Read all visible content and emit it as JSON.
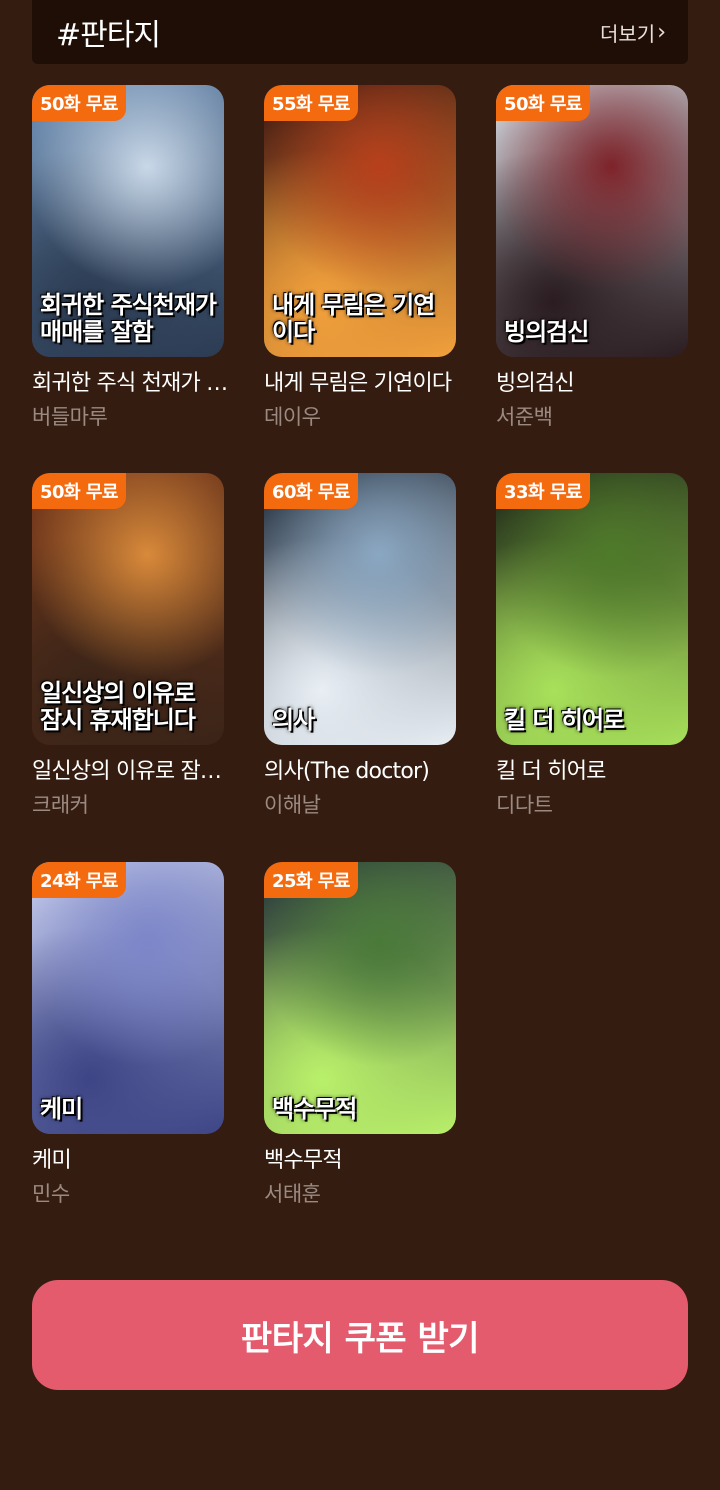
{
  "header": {
    "title": "#판타지",
    "more_label": "더보기",
    "more_icon": "chevron-right-icon"
  },
  "books": [
    {
      "badge": "50화 무료",
      "title": "회귀한 주식 천재가 매매를 잘함",
      "author": "버들마루",
      "cover_text": "회귀한 주식천재가 매매를 잘함",
      "colors": [
        "#6e8fb5",
        "#c9d8e8",
        "#2b3b52"
      ]
    },
    {
      "badge": "55화 무료",
      "title": "내게 무림은 기연이다",
      "author": "데이우",
      "cover_text": "내게 무림은 기연이다",
      "colors": [
        "#3a1410",
        "#b8401c",
        "#f2a13c"
      ]
    },
    {
      "badge": "50화 무료",
      "title": "빙의검신",
      "author": "서준백",
      "cover_text": "빙의검신",
      "colors": [
        "#d7dbe2",
        "#7d2329",
        "#2a1c20"
      ]
    },
    {
      "badge": "50화 무료",
      "title": "일신상의 이유로 잠시 휴재합니다",
      "author": "크래커",
      "cover_text": "일신상의 이유로 잠시 휴재합니다",
      "colors": [
        "#7a3a1c",
        "#d98a3a",
        "#3a2418"
      ]
    },
    {
      "badge": "60화 무료",
      "title": "의사(The doctor)",
      "author": "이해날",
      "cover_text": "의사",
      "colors": [
        "#1c2a3a",
        "#8aa7c2",
        "#e8eef4"
      ]
    },
    {
      "badge": "33화 무료",
      "title": "킬 더 히어로",
      "author": "디다트",
      "cover_text": "킬 더 히어로",
      "colors": [
        "#1a2216",
        "#4f7a2a",
        "#a8e05a"
      ]
    },
    {
      "badge": "24화 무료",
      "title": "케미",
      "author": "민수",
      "cover_text": "케미",
      "colors": [
        "#c8cff0",
        "#7c86c9",
        "#3d4586"
      ]
    },
    {
      "badge": "25화 무료",
      "title": "백수무적",
      "author": "서태훈",
      "cover_text": "백수무적",
      "colors": [
        "#23303a",
        "#4a7a3a",
        "#b9f06a"
      ]
    }
  ],
  "coupon": {
    "label": "판타지 쿠폰 받기"
  }
}
